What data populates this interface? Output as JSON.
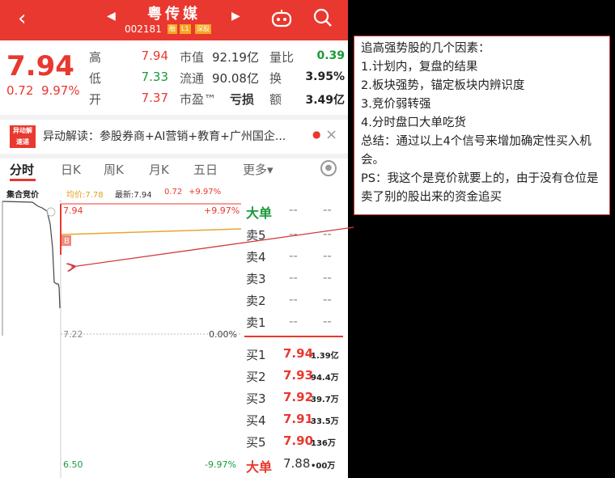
{
  "header": {
    "stock_name": "粤传媒",
    "stock_code": "002181",
    "tags": [
      "融",
      "L1",
      "深股"
    ]
  },
  "quote": {
    "price": "7.94",
    "change": "0.72",
    "change_pct": "9.97%",
    "high_label": "高",
    "high": "7.94",
    "low_label": "低",
    "low": "7.33",
    "open_label": "开",
    "open": "7.37",
    "mktcap_label": "市值",
    "mktcap": "92.19亿",
    "float_label": "流通",
    "float": "90.08亿",
    "pe_label": "市盈™",
    "pe": "亏损",
    "vol_ratio_label": "量比",
    "vol_ratio": "0.39",
    "turnover_label": "换",
    "turnover": "3.95%",
    "amount_label": "额",
    "amount": "3.49亿"
  },
  "news": {
    "logo_line1": "异动解",
    "logo_line2": "速递",
    "text": "异动解读：参股券商+AI营销+教育+广州国企..."
  },
  "tabs": [
    "分时",
    "日K",
    "周K",
    "月K",
    "五日",
    "更多▾"
  ],
  "chart_info": {
    "auction_label": "集合竞价",
    "avg_label": "均价:7.78",
    "latest_label": "最新:7.94",
    "latest_change": "0.72",
    "latest_pct": "+9.97%"
  },
  "chart_data": {
    "type": "line",
    "y_top": "7.94",
    "y_top_pct": "+9.97%",
    "y_mid": "7.22",
    "y_mid_pct": "0.00%",
    "y_bottom": "6.50",
    "y_bottom_pct": "-9.97%",
    "ylim": [
      6.5,
      7.94
    ],
    "avg_price": 7.78,
    "marker_label": "B"
  },
  "orderbook": {
    "big_label": "大单",
    "dash": "--",
    "asks": [
      {
        "label": "卖5"
      },
      {
        "label": "卖4"
      },
      {
        "label": "卖3"
      },
      {
        "label": "卖2"
      },
      {
        "label": "卖1"
      }
    ],
    "bids": [
      {
        "label": "买1",
        "price": "7.94",
        "vol": "1.39亿"
      },
      {
        "label": "买2",
        "price": "7.93",
        "vol": "94.4万"
      },
      {
        "label": "买3",
        "price": "7.92",
        "vol": "39.7万"
      },
      {
        "label": "买4",
        "price": "7.91",
        "vol": "33.5万"
      },
      {
        "label": "买5",
        "price": "7.90",
        "vol": "136万"
      }
    ],
    "bottom_big_label": "大单",
    "bottom_price": "7.88",
    "bottom_vol": "•00万"
  },
  "note": {
    "lines": [
      "追高强势股的几个因素：",
      "1.计划内，复盘的结果",
      "2.板块强势，锚定板块内辨识度",
      "3.竞价弱转强",
      "4.分时盘口大单吃货",
      "总结：通过以上4个信号来增加确定性买入机会。",
      "PS：我这个是竞价就要上的，由于没有仓位是卖了别的股出来的资金追买"
    ]
  }
}
